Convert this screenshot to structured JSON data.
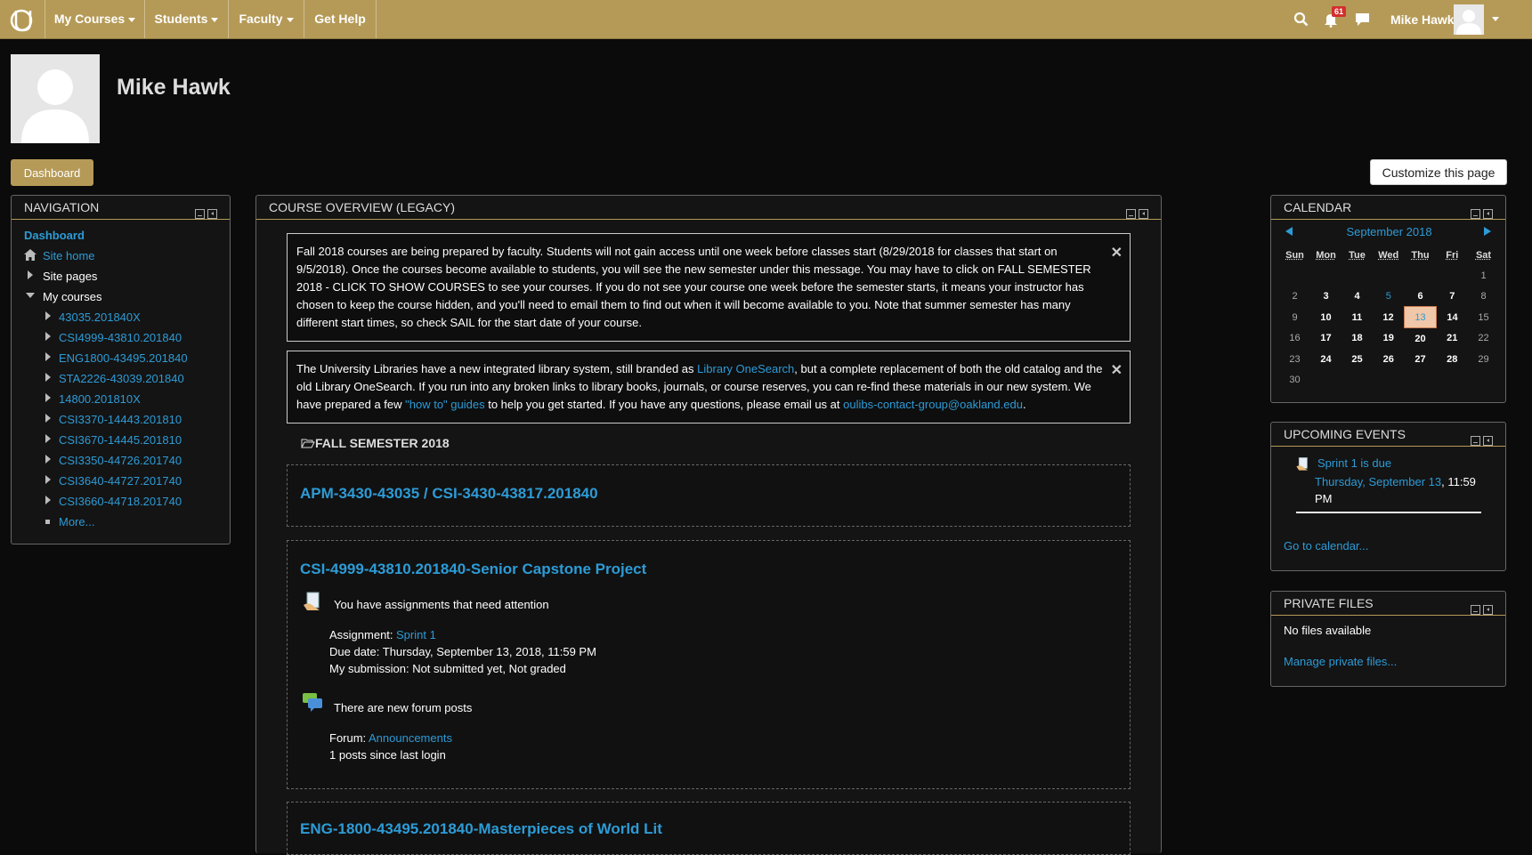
{
  "topbar": {
    "menus": [
      "My Courses",
      "Students",
      "Faculty",
      "Get Help"
    ],
    "notification_count": "61",
    "user_name": "Mike Hawk",
    "bg_color": "#b59a57"
  },
  "header": {
    "user_name": "Mike Hawk",
    "dashboard_label": "Dashboard",
    "customize_label": "Customize this page"
  },
  "navigation": {
    "title": "NAVIGATION",
    "dashboard": "Dashboard",
    "site_home": "Site home",
    "site_pages": "Site pages",
    "my_courses": "My courses",
    "courses": [
      "43035.201840X",
      "CSI4999-43810.201840",
      "ENG1800-43495.201840",
      "STA2226-43039.201840",
      "14800.201810X",
      "CSI3370-14443.201810",
      "CSI3670-14445.201810",
      "CSI3350-44726.201740",
      "CSI3640-44727.201740",
      "CSI3660-44718.201740"
    ],
    "more": "More..."
  },
  "overview": {
    "title": "COURSE OVERVIEW (LEGACY)",
    "alert1": "Fall 2018 courses are being prepared by faculty. Students will not gain access until one week before classes start (8/29/2018 for classes that start on 9/5/2018). Once the courses become available to students, you will see the new semester under this message. You may have to click on FALL SEMESTER 2018 - CLICK TO SHOW COURSES to see your courses. If you do not see your course one week before the semester starts, it means your instructor has chosen to keep the course hidden, and you'll need to email them to find out when it will become available to you. Note that summer semester has many different start times, so check SAIL for the start date of your course.",
    "alert2_a": "The University Libraries have a new integrated library system, still branded as ",
    "alert2_link1": "Library OneSearch",
    "alert2_b": ", but a complete replacement of both the old catalog and the old Library OneSearch. If you run into any broken links to library books, journals, or course reserves, you can re-find these materials in our new system. We have prepared a few ",
    "alert2_link2": "\"how to\" guides",
    "alert2_c": " to help you get started. If you have any questions, please email us at ",
    "alert2_link3": "oulibs-contact-group@oakland.edu",
    "alert2_d": ".",
    "semester": "FALL SEMESTER 2018",
    "course1": "APM-3430-43035 / CSI-3430-43817.201840",
    "course2": "CSI-4999-43810.201840-Senior Capstone Project",
    "assign_attention": "You have assignments that need attention",
    "assign_label": "Assignment: ",
    "assign_link": "Sprint 1",
    "due_date": "Due date: Thursday, September 13, 2018, 11:59 PM",
    "submission": "My submission: Not submitted yet, Not graded",
    "forum_new": "There are new forum posts",
    "forum_label": "Forum: ",
    "forum_link": "Announcements",
    "forum_posts": "1 posts since last login",
    "course3": "ENG-1800-43495.201840-Masterpieces of World Lit"
  },
  "calendar": {
    "title": "CALENDAR",
    "month": "September 2018",
    "days": [
      "Sun",
      "Mon",
      "Tue",
      "Wed",
      "Thu",
      "Fri",
      "Sat"
    ],
    "weeks": [
      [
        "",
        "",
        "",
        "",
        "",
        "",
        "1"
      ],
      [
        "2",
        "3",
        "4",
        "5",
        "6",
        "7",
        "8"
      ],
      [
        "9",
        "10",
        "11",
        "12",
        "13",
        "14",
        "15"
      ],
      [
        "16",
        "17",
        "18",
        "19",
        "20",
        "21",
        "22"
      ],
      [
        "23",
        "24",
        "25",
        "26",
        "27",
        "28",
        "29"
      ],
      [
        "30",
        "",
        "",
        "",
        "",
        "",
        ""
      ]
    ],
    "event_day": "5",
    "today": "13"
  },
  "upcoming": {
    "title": "UPCOMING EVENTS",
    "event_name": "Sprint 1 is due",
    "event_date": "Thursday, September 13",
    "event_time": ", 11:59 PM",
    "go_calendar": "Go to calendar..."
  },
  "private_files": {
    "title": "PRIVATE FILES",
    "none": "No files available",
    "manage": "Manage private files..."
  }
}
